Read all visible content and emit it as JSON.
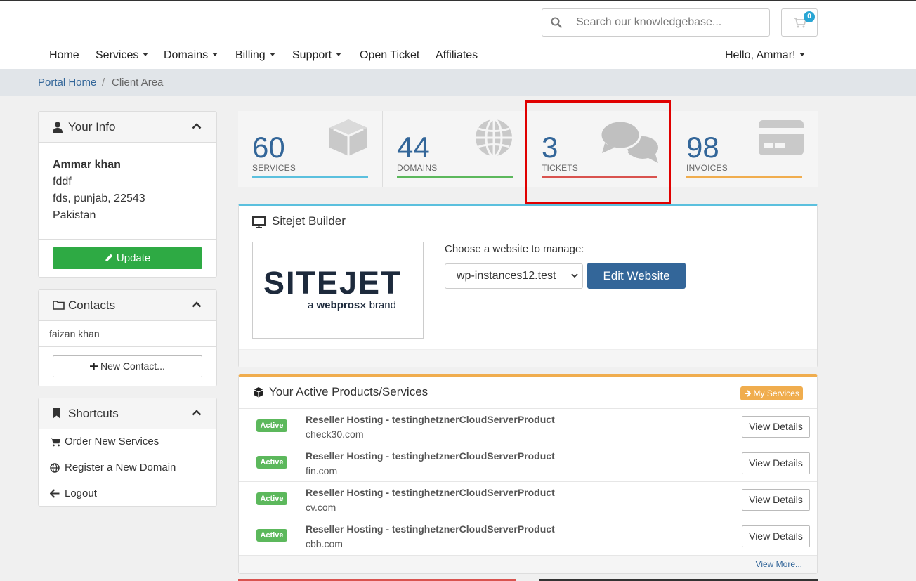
{
  "header": {
    "search_placeholder": "Search our knowledgebase...",
    "cart_count": "0",
    "nav": [
      {
        "label": "Home",
        "dropdown": false
      },
      {
        "label": "Services",
        "dropdown": true
      },
      {
        "label": "Domains",
        "dropdown": true
      },
      {
        "label": "Billing",
        "dropdown": true
      },
      {
        "label": "Support",
        "dropdown": true
      },
      {
        "label": "Open Ticket",
        "dropdown": false
      },
      {
        "label": "Affiliates",
        "dropdown": false
      }
    ],
    "user_menu": "Hello, Ammar!"
  },
  "breadcrumb": {
    "home": "Portal Home",
    "separator": "/",
    "current": "Client Area"
  },
  "sidebar": {
    "your_info": {
      "title": "Your Info",
      "name": "Ammar khan",
      "line1": "fddf",
      "line2": "fds, punjab, 22543",
      "country": "Pakistan",
      "update_label": "Update"
    },
    "contacts": {
      "title": "Contacts",
      "items": [
        "faizan khan"
      ],
      "new_contact_label": "New Contact..."
    },
    "shortcuts": {
      "title": "Shortcuts",
      "items": [
        {
          "label": "Order New Services",
          "icon": "cart-icon"
        },
        {
          "label": "Register a New Domain",
          "icon": "globe-icon"
        },
        {
          "label": "Logout",
          "icon": "arrow-left-icon"
        }
      ]
    }
  },
  "stats": [
    {
      "value": "60",
      "label": "SERVICES",
      "color": "#5bc0de",
      "icon": "cube-icon"
    },
    {
      "value": "44",
      "label": "DOMAINS",
      "color": "#5cb85c",
      "icon": "globe-icon"
    },
    {
      "value": "3",
      "label": "TICKETS",
      "color": "#d9534f",
      "icon": "comments-icon"
    },
    {
      "value": "98",
      "label": "INVOICES",
      "color": "#f0ad4e",
      "icon": "credit-card-icon"
    }
  ],
  "sitejet": {
    "title": "Sitejet Builder",
    "logo_word": "SITEJET",
    "logo_prefix": "a",
    "logo_brand": "webpros",
    "logo_suffix": "brand",
    "choose_label": "Choose a website to manage:",
    "selected_site": "wp-instances12.test",
    "edit_label": "Edit Website"
  },
  "products": {
    "title": "Your Active Products/Services",
    "my_services_label": "My Services",
    "status_label": "Active",
    "view_details_label": "View Details",
    "view_more_label": "View More...",
    "rows": [
      {
        "name": "Reseller Hosting - testinghetznerCloudServerProduct",
        "domain": "check30.com"
      },
      {
        "name": "Reseller Hosting - testinghetznerCloudServerProduct",
        "domain": "fin.com"
      },
      {
        "name": "Reseller Hosting - testinghetznerCloudServerProduct",
        "domain": "cv.com"
      },
      {
        "name": "Reseller Hosting - testinghetznerCloudServerProduct",
        "domain": "cbb.com"
      }
    ]
  },
  "highlight_color": "#e00000"
}
